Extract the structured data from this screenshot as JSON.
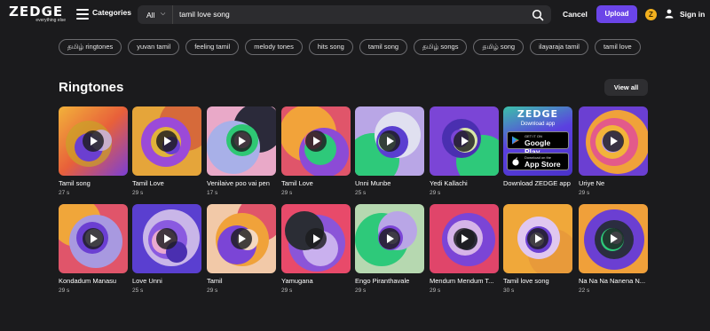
{
  "header": {
    "logo": "ZEDGE",
    "logo_sub": "everything else",
    "categories_label": "Categories",
    "search_category": "All",
    "search_value": "tamil love song",
    "cancel_label": "Cancel",
    "upload_label": "Upload",
    "coin_label": "Z",
    "signin_label": "Sign in",
    "accent_color": "#6b45e8"
  },
  "tags": [
    "தமிழ் ringtones",
    "yuvan tamil",
    "feeling tamil",
    "melody tones",
    "hits song",
    "tamil song",
    "தமிழ் songs",
    "தமிழ் song",
    "ilayaraja tamil",
    "tamil love"
  ],
  "section": {
    "title": "Ringtones",
    "view_all": "View all"
  },
  "row1": [
    {
      "title": "Tamil song",
      "duration": "27 s"
    },
    {
      "title": "Tamil Love",
      "duration": "29 s"
    },
    {
      "title": "Venilaive poo vai pen",
      "duration": "17 s"
    },
    {
      "title": "Tamil Love",
      "duration": "29 s"
    },
    {
      "title": "Unni Munbe",
      "duration": "25 s"
    },
    {
      "title": "Yedi Kallachi",
      "duration": "29 s"
    },
    {
      "title": "Download ZEDGE app",
      "duration": ""
    },
    {
      "title": "Uriye Ne",
      "duration": "29 s"
    }
  ],
  "row2": [
    {
      "title": "Kondadum Manasu",
      "duration": "29 s"
    },
    {
      "title": "Love Unni",
      "duration": "25 s"
    },
    {
      "title": "Tamil",
      "duration": "29 s"
    },
    {
      "title": "Yamugana",
      "duration": "29 s"
    },
    {
      "title": "Engo Piranthavale",
      "duration": "29 s"
    },
    {
      "title": "Mendum Mendum T...",
      "duration": "29 s"
    },
    {
      "title": "Tamil love song",
      "duration": "30 s"
    },
    {
      "title": "Na Na Na Nanena N...",
      "duration": "22 s"
    }
  ],
  "promo": {
    "logo": "ZEDGE",
    "subtitle": "Download app",
    "gplay_top": "GET IT ON",
    "gplay_main": "Google Play",
    "appstore_top": "Download on the",
    "appstore_main": "App Store"
  }
}
